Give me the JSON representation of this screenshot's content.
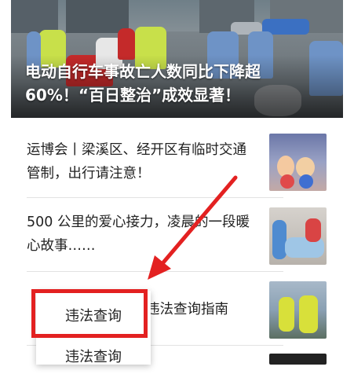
{
  "hero": {
    "title": "电动自行车事故亡人数同比下降超60%！“百日整治”成效显著！"
  },
  "news": [
    {
      "title": "运博会丨梁溪区、经开区有临时交通管制，出行请注意！",
      "thumb": "event-mascot-image"
    },
    {
      "title": "500 公里的爱心接力，凌晨的一段暖心故事……",
      "thumb": "medical-rescue-image"
    },
    {
      "title": "违法查询指南",
      "thumb": "traffic-police-image"
    },
    {
      "title": "",
      "thumb": "dark-thumbnail-image"
    }
  ],
  "popup_menu": {
    "items": [
      "违法查询",
      "违法查询"
    ]
  },
  "annotation": {
    "arrow_color": "#e32121",
    "highlight_color": "#e32121"
  }
}
